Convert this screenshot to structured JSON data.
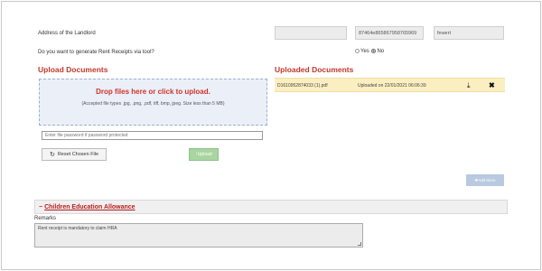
{
  "landlord": {
    "address_label": "Address of the Landlord",
    "field_empty": "",
    "field_pan": "87464e865867958765969",
    "field_name": "fewert"
  },
  "rent_receipts": {
    "question": "Do you want to generate Rent Receipts via tool?",
    "option_yes": "Yes",
    "option_no": "No",
    "selected": "No"
  },
  "upload": {
    "title": "Upload Documents",
    "drop_title": "Drop files here or click to upload.",
    "drop_subtitle": "(Accepted file types .jpg, .png, .pdf, tiff, bmp, jpeg. Size less than 5 MB)",
    "password_placeholder": "Enter file password if password protected",
    "reset_label": "Reset Chosen File",
    "upload_label": "↑Upload"
  },
  "uploaded": {
    "title": "Uploaded Documents",
    "files": [
      {
        "name": "D1610952874033 (1).pdf",
        "uploaded_text": "Uploaded on 22/01/2021 06:06:39"
      }
    ]
  },
  "add_more_label": "✚Add More",
  "children_allowance": {
    "title": "Children Education Allowance"
  },
  "remarks": {
    "label": "Remarks",
    "value": "Rent receipt is mandatory to claim HRA"
  },
  "colors": {
    "accent_red": "#d0342c",
    "dropzone_bg": "#ebeff7",
    "uploaded_row_bg": "#fbefc1",
    "upload_button_bg": "#a8d5a0",
    "add_more_bg": "#b8c9e0"
  }
}
